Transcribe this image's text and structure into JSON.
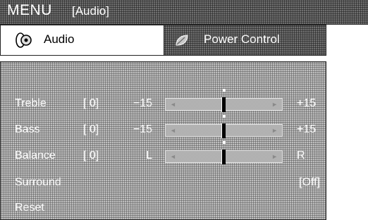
{
  "title": {
    "menu": "MENU",
    "section": "[Audio]"
  },
  "tabs": [
    {
      "label": "Audio",
      "icon": "speaker-icon",
      "selected": true
    },
    {
      "label": "Power Control",
      "icon": "leaf-icon",
      "selected": false
    }
  ],
  "rows": {
    "treble": {
      "label": "Treble",
      "value": "[ 0]",
      "min": "−15",
      "max": "+15",
      "level": 0
    },
    "bass": {
      "label": "Bass",
      "value": "[ 0]",
      "min": "−15",
      "max": "+15",
      "level": 0
    },
    "balance": {
      "label": "Balance",
      "value": "[ 0]",
      "min": "L",
      "max": "R",
      "level": 0
    },
    "surround": {
      "label": "Surround",
      "value": "[Off]"
    },
    "reset": {
      "label": "Reset"
    }
  },
  "slider": {
    "arrow_left": "◄",
    "arrow_right": "►"
  }
}
